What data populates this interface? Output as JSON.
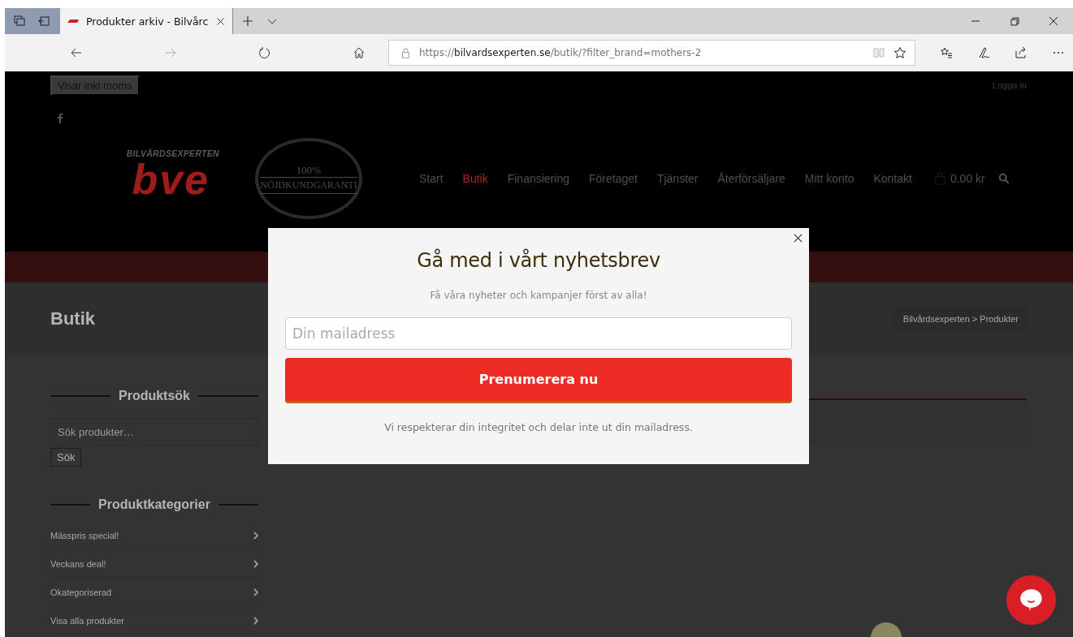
{
  "browser": {
    "tab_title": "Produkter arkiv - Bilvårc",
    "url": "https://**bilvardsexperten.se**/butik/?filter_brand=mothers-2"
  },
  "header": {
    "tax_toggle": "Visar inkl moms",
    "login": "Logga in",
    "logo": {
      "tagline": "BILVÅRDSEXPERTEN",
      "wordmark": "bve"
    },
    "badge": {
      "percent": "100%",
      "label": "NÖJDKUNDGARANTI"
    },
    "nav": [
      {
        "label": "Start",
        "selected": false
      },
      {
        "label": "Butik",
        "selected": true
      },
      {
        "label": "Finansiering",
        "selected": false
      },
      {
        "label": "Företaget",
        "selected": false
      },
      {
        "label": "Tjänster",
        "selected": false
      },
      {
        "label": "Återförsäljare",
        "selected": false
      },
      {
        "label": "Mitt konto",
        "selected": false
      },
      {
        "label": "Kontakt",
        "selected": false
      }
    ],
    "cart": "0.00 kr"
  },
  "page_title": "Butik",
  "breadcrumb": "Bilvårdsexperten > Produkter",
  "sidebar": {
    "search": {
      "heading": "Produktsök",
      "placeholder": "Sök produkter…",
      "button": "Sök"
    },
    "categories": {
      "heading": "Produktkategorier",
      "items": [
        "Mässpris special!",
        "Veckans deal!",
        "Okategoriserad",
        "Visa alla produkter"
      ]
    }
  },
  "newsletter": {
    "title": "Gå med i vårt nyhetsbrev",
    "subtitle": "Få våra nyheter och kampanjer först av alla!",
    "placeholder": "Din mailadress",
    "button": "Prenumerera nu",
    "note": "Vi respekterar din integritet och delar inte ut din mailadress."
  }
}
